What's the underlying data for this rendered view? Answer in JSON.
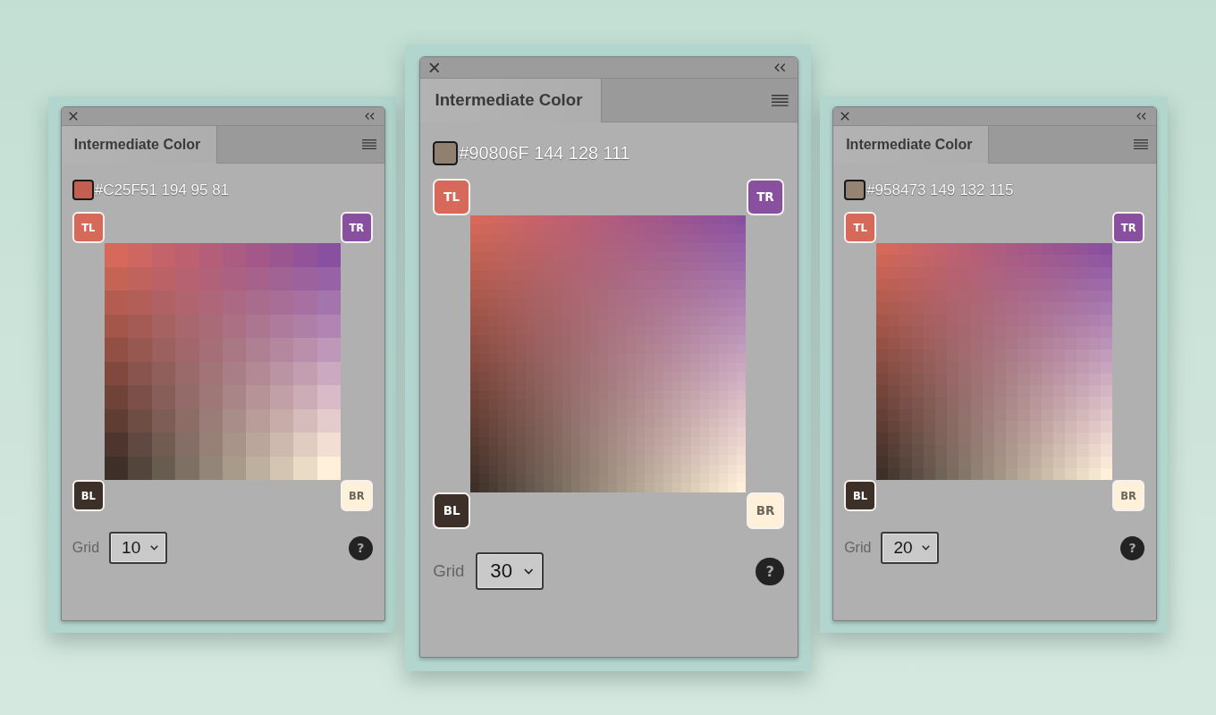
{
  "panels": [
    {
      "tabs": [
        {
          "label": "Intermediate Color",
          "selected": true
        }
      ],
      "swatch": {
        "color": "#c25f51",
        "value": "#C25F51 194 95 81"
      },
      "corners": [
        {
          "label": "TL",
          "color": "#d6695a"
        },
        {
          "label": "TR",
          "color": "#8a50a0"
        },
        {
          "label": "BL",
          "color": "#3d3028"
        },
        {
          "label": "BR",
          "color": "#fff0d9"
        }
      ],
      "grid_label": "Grid",
      "grid_size": "10",
      "help": "?"
    },
    {
      "tabs": [
        {
          "label": "Intermediate Color",
          "selected": true
        }
      ],
      "swatch": {
        "color": "#90806f",
        "value": "#90806F 144 128 111"
      },
      "corners": [
        {
          "label": "TL",
          "color": "#d6695a"
        },
        {
          "label": "TR",
          "color": "#8a50a0"
        },
        {
          "label": "BL",
          "color": "#3d3028"
        },
        {
          "label": "BR",
          "color": "#fff0d9"
        }
      ],
      "grid_label": "Grid",
      "grid_size": "30",
      "help": "?"
    },
    {
      "tabs": [
        {
          "label": "Intermediate Color",
          "selected": true
        }
      ],
      "swatch": {
        "color": "#958473",
        "value": "#958473 149 132 115"
      },
      "corners": [
        {
          "label": "TL",
          "color": "#d6695a"
        },
        {
          "label": "TR",
          "color": "#8a50a0"
        },
        {
          "label": "BL",
          "color": "#3d3028"
        },
        {
          "label": "BR",
          "color": "#fff0d9"
        }
      ],
      "grid_label": "Grid",
      "grid_size": "20",
      "help": "?"
    }
  ]
}
